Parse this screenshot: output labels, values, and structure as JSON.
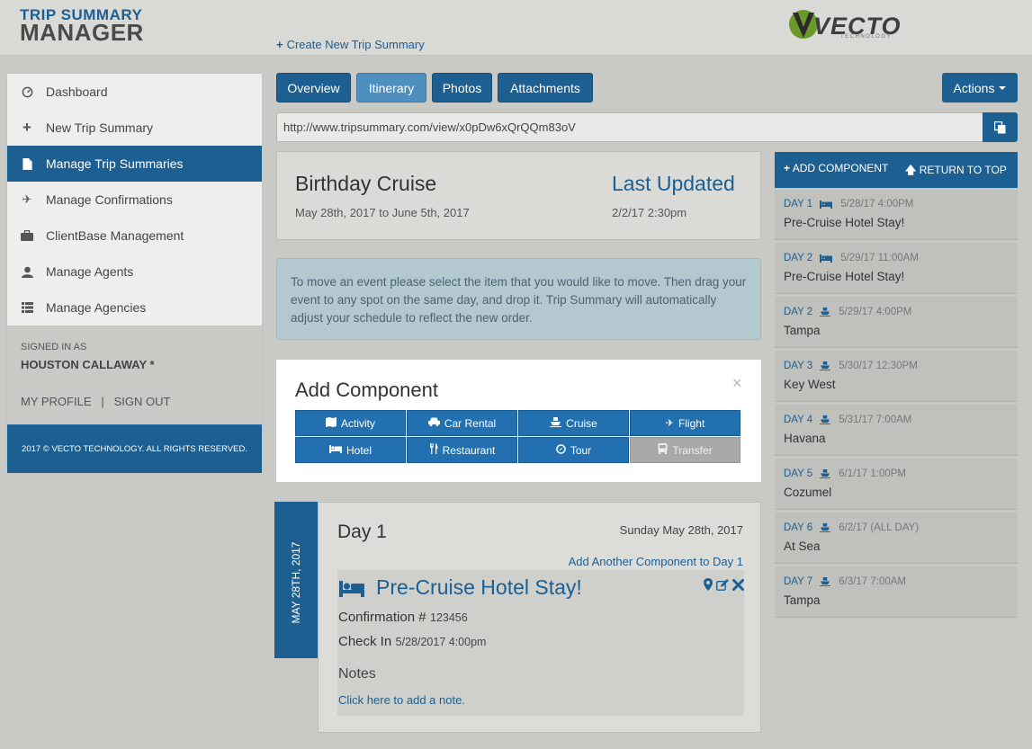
{
  "header": {
    "logo_top": "TRIP SUMMARY",
    "logo_bottom": "MANAGER",
    "create_link": "Create New Trip Summary",
    "brand": "VECTO",
    "brand_sub": "TECHNOLOGY"
  },
  "sidebar": {
    "items": [
      {
        "label": "Dashboard",
        "icon": "dashboard-icon"
      },
      {
        "label": "New Trip Summary",
        "icon": "plus-icon"
      },
      {
        "label": "Manage Trip Summaries",
        "icon": "document-icon",
        "active": true
      },
      {
        "label": "Manage Confirmations",
        "icon": "plane-icon"
      },
      {
        "label": "ClientBase Management",
        "icon": "briefcase-icon"
      },
      {
        "label": "Manage Agents",
        "icon": "user-icon"
      },
      {
        "label": "Manage Agencies",
        "icon": "list-icon"
      }
    ],
    "signed_in_label": "SIGNED IN AS",
    "user_name": "HOUSTON CALLAWAY *",
    "my_profile": "MY PROFILE",
    "separator": "|",
    "sign_out": "SIGN OUT",
    "footer": "2017 © VECTO TECHNOLOGY. ALL RIGHTS RESERVED."
  },
  "tabs": [
    {
      "label": "Overview"
    },
    {
      "label": "Itinerary",
      "active": true
    },
    {
      "label": "Photos"
    },
    {
      "label": "Attachments"
    }
  ],
  "actions_label": "Actions",
  "share_url": "http://www.tripsummary.com/view/x0pDw6xQrQQm83oV",
  "trip": {
    "title": "Birthday Cruise",
    "dates": "May 28th, 2017 to June 5th, 2017",
    "last_updated_label": "Last Updated",
    "last_updated_value": "2/2/17 2:30pm"
  },
  "info_text": "To move an event please select the item that you would like to move. Then drag your event to any spot on the same day, and drop it. Trip Summary will automatically adjust your schedule to reflect the new order.",
  "add_component": {
    "title": "Add Component",
    "close": "×",
    "buttons": [
      {
        "label": "Activity",
        "icon": "map-icon"
      },
      {
        "label": "Car Rental",
        "icon": "car-icon"
      },
      {
        "label": "Cruise",
        "icon": "ship-icon"
      },
      {
        "label": "Flight",
        "icon": "plane-icon"
      },
      {
        "label": "Hotel",
        "icon": "bed-icon"
      },
      {
        "label": "Restaurant",
        "icon": "cutlery-icon"
      },
      {
        "label": "Tour",
        "icon": "compass-icon"
      },
      {
        "label": "Transfer",
        "icon": "bus-icon",
        "disabled": true
      }
    ]
  },
  "day": {
    "rail_label": "MAY 28TH, 2017",
    "title": "Day 1",
    "date": "Sunday May 28th, 2017",
    "add_another": "Add Another Component to Day 1",
    "component": {
      "name": "Pre-Cruise Hotel Stay!",
      "confirmation_label": "Confirmation #",
      "confirmation_value": "123456",
      "checkin_label": "Check In",
      "checkin_value": "5/28/2017 4:00pm",
      "notes_label": "Notes",
      "add_note": "Click here to add a note."
    }
  },
  "right_panel": {
    "add_component": "ADD COMPONENT",
    "return_top": "RETURN TO TOP",
    "items": [
      {
        "day": "DAY 1",
        "icon": "bed-icon",
        "time": "5/28/17 4:00PM",
        "name": "Pre-Cruise Hotel Stay!"
      },
      {
        "day": "DAY 2",
        "icon": "bed-icon",
        "time": "5/29/17 11:00AM",
        "name": "Pre-Cruise Hotel Stay!"
      },
      {
        "day": "DAY 2",
        "icon": "ship-icon",
        "time": "5/29/17 4:00PM",
        "name": "Tampa"
      },
      {
        "day": "DAY 3",
        "icon": "ship-icon",
        "time": "5/30/17 12:30PM",
        "name": "Key West"
      },
      {
        "day": "DAY 4",
        "icon": "ship-icon",
        "time": "5/31/17 7:00AM",
        "name": "Havana"
      },
      {
        "day": "DAY 5",
        "icon": "ship-icon",
        "time": "6/1/17 1:00PM",
        "name": "Cozumel"
      },
      {
        "day": "DAY 6",
        "icon": "ship-icon",
        "time": "6/2/17 (ALL DAY)",
        "name": "At Sea"
      },
      {
        "day": "DAY 7",
        "icon": "ship-icon",
        "time": "6/3/17 7:00AM",
        "name": "Tampa"
      }
    ]
  },
  "colors": {
    "primary": "#1e5f92",
    "tab_active": "#4f8fc0",
    "button_blue": "#2270af",
    "info_bg": "#b3c8cf",
    "brand_green": "#6b9a2a"
  }
}
